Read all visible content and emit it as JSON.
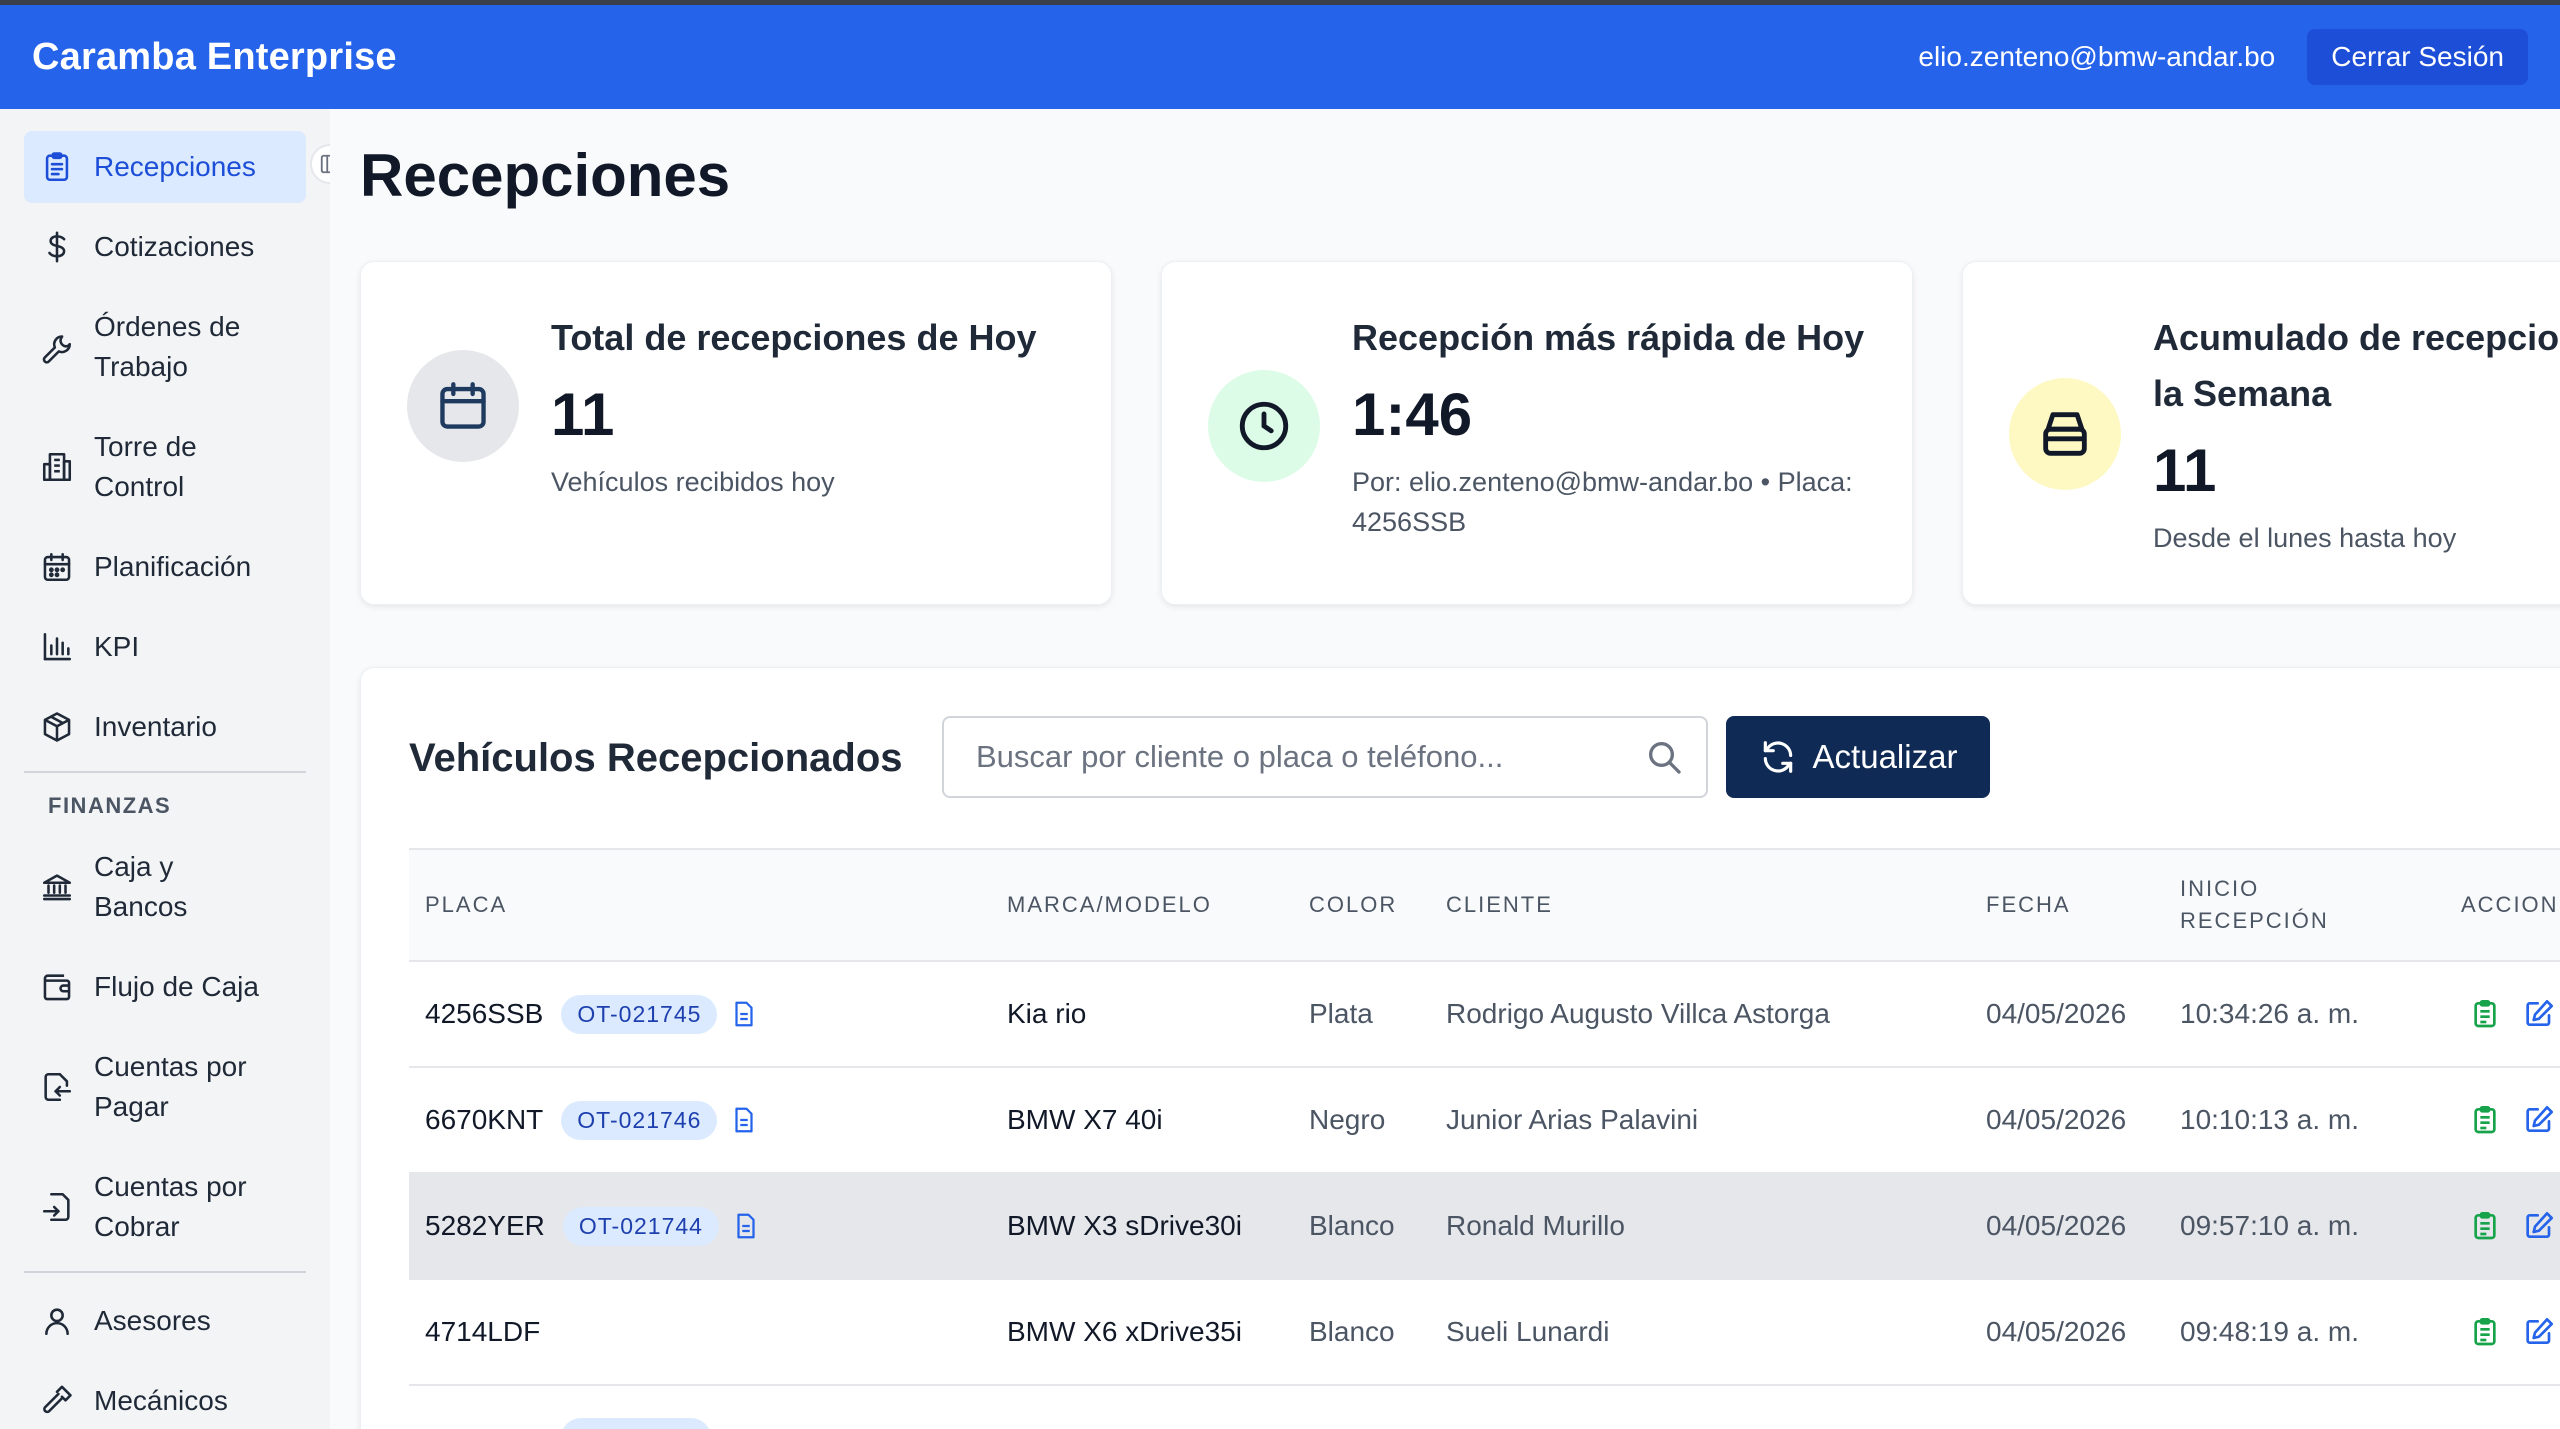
{
  "header": {
    "brand": "Caramba Enterprise",
    "user_email": "elio.zenteno@bmw-andar.bo",
    "logout_label": "Cerrar Sesión",
    "accent": "#2563eb"
  },
  "sidebar": {
    "items": [
      {
        "label": "Recepciones",
        "icon": "clipboard-icon",
        "active": true
      },
      {
        "label": "Cotizaciones",
        "icon": "dollar-icon"
      },
      {
        "label": "Órdenes de Trabajo",
        "icon": "wrench-icon"
      },
      {
        "label": "Torre de Control",
        "icon": "building-icon"
      },
      {
        "label": "Planificación",
        "icon": "calendar-icon"
      },
      {
        "label": "KPI",
        "icon": "bar-chart-icon"
      },
      {
        "label": "Inventario",
        "icon": "box-icon"
      }
    ],
    "section_finance": "FINANZAS",
    "finance_items": [
      {
        "label": "Caja y Bancos",
        "icon": "bank-icon"
      },
      {
        "label": "Flujo de Caja",
        "icon": "wallet-icon"
      },
      {
        "label": "Cuentas por Pagar",
        "icon": "export-icon"
      },
      {
        "label": "Cuentas por Cobrar",
        "icon": "import-icon"
      }
    ],
    "other_items": [
      {
        "label": "Asesores",
        "icon": "user-icon"
      },
      {
        "label": "Mecánicos",
        "icon": "hammer-icon"
      }
    ]
  },
  "page": {
    "title": "Recepciones"
  },
  "cards": [
    {
      "title": "Total de recepciones de Hoy",
      "value": "11",
      "sub": "Vehículos recibidos hoy",
      "icon": "calendar-icon",
      "icon_bg": "#e5e7eb"
    },
    {
      "title": "Recepción más rápida de Hoy",
      "value": "1:46",
      "sub": "Por: elio.zenteno@bmw-andar.bo • Placa: 4256SSB",
      "icon": "clock-icon",
      "icon_bg": "#dcfce7"
    },
    {
      "title": "Acumulado de recepciones de la Semana",
      "value": "11",
      "sub": "Desde el lunes hasta hoy",
      "icon": "inbox-icon",
      "icon_bg": "#fef9c3"
    }
  ],
  "panel": {
    "title": "Vehículos Recepcionados",
    "search_placeholder": "Buscar por cliente o placa o teléfono...",
    "refresh_label": "Actualizar"
  },
  "table": {
    "headers": {
      "placa": "PLACA",
      "marca": "MARCA/MODELO",
      "color": "COLOR",
      "cliente": "CLIENTE",
      "fecha": "FECHA",
      "inicio": "INICIO RECEPCIÓN",
      "acciones": "ACCIONES"
    },
    "rows": [
      {
        "placa": "4256SSB",
        "ot": "OT-021745",
        "marca": "Kia rio",
        "color": "Plata",
        "cliente": "Rodrigo Augusto Villca Astorga",
        "fecha": "04/05/2026",
        "inicio": "10:34:26 a. m."
      },
      {
        "placa": "6670KNT",
        "ot": "OT-021746",
        "marca": "BMW X7 40i",
        "color": "Negro",
        "cliente": "Junior Arias Palavini",
        "fecha": "04/05/2026",
        "inicio": "10:10:13 a. m."
      },
      {
        "placa": "5282YER",
        "ot": "OT-021744",
        "marca": "BMW X3 sDrive30i",
        "color": "Blanco",
        "cliente": "Ronald Murillo",
        "fecha": "04/05/2026",
        "inicio": "09:57:10 a. m."
      },
      {
        "placa": "4714LDF",
        "ot": "",
        "marca": "BMW X6 xDrive35i",
        "color": "Blanco",
        "cliente": "Sueli Lunardi",
        "fecha": "04/05/2026",
        "inicio": "09:48:19 a. m."
      }
    ]
  }
}
